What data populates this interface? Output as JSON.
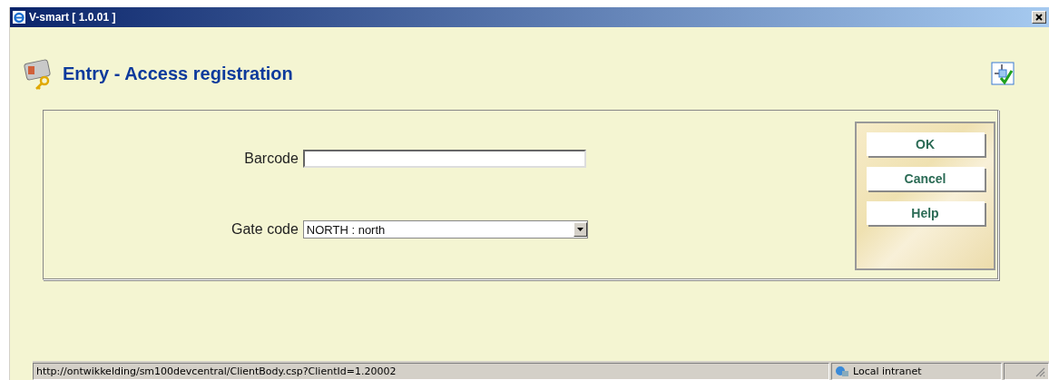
{
  "window": {
    "title": "V-smart [ 1.0.01 ]"
  },
  "page": {
    "title": "Entry - Access registration"
  },
  "form": {
    "fields": [
      {
        "kind": "text",
        "label": "Barcode"
      },
      {
        "kind": "select",
        "label": "Gate code",
        "value": "NORTH : north"
      }
    ]
  },
  "buttons": [
    "OK",
    "Cancel",
    "Help"
  ],
  "status_bar": {
    "url": "http://ontwikkelding/sm100devcentral/ClientBody.csp?ClientId=1.20002",
    "zone": "Local intranet"
  }
}
